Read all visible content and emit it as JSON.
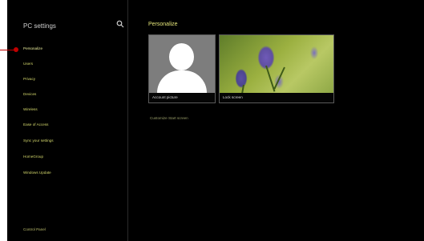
{
  "sidebar": {
    "title": "PC settings",
    "items": [
      {
        "label": "Personalize",
        "selected": true
      },
      {
        "label": "Users",
        "selected": false
      },
      {
        "label": "Privacy",
        "selected": false
      },
      {
        "label": "Devices",
        "selected": false
      },
      {
        "label": "Wireless",
        "selected": false
      },
      {
        "label": "Ease of Access",
        "selected": false
      },
      {
        "label": "Sync your settings",
        "selected": false
      },
      {
        "label": "HomeGroup",
        "selected": false
      },
      {
        "label": "Windows Update",
        "selected": false
      }
    ],
    "footer": "Control Panel"
  },
  "main": {
    "title": "Personalize",
    "tiles": [
      {
        "label": "Account picture",
        "icon": "user-avatar"
      },
      {
        "label": "Lock screen",
        "icon": "lavender-photo"
      }
    ],
    "link": "Customize Start screen"
  },
  "colors": {
    "accent": "#d4d86c",
    "background": "#000000",
    "cursor": "#c00000"
  }
}
